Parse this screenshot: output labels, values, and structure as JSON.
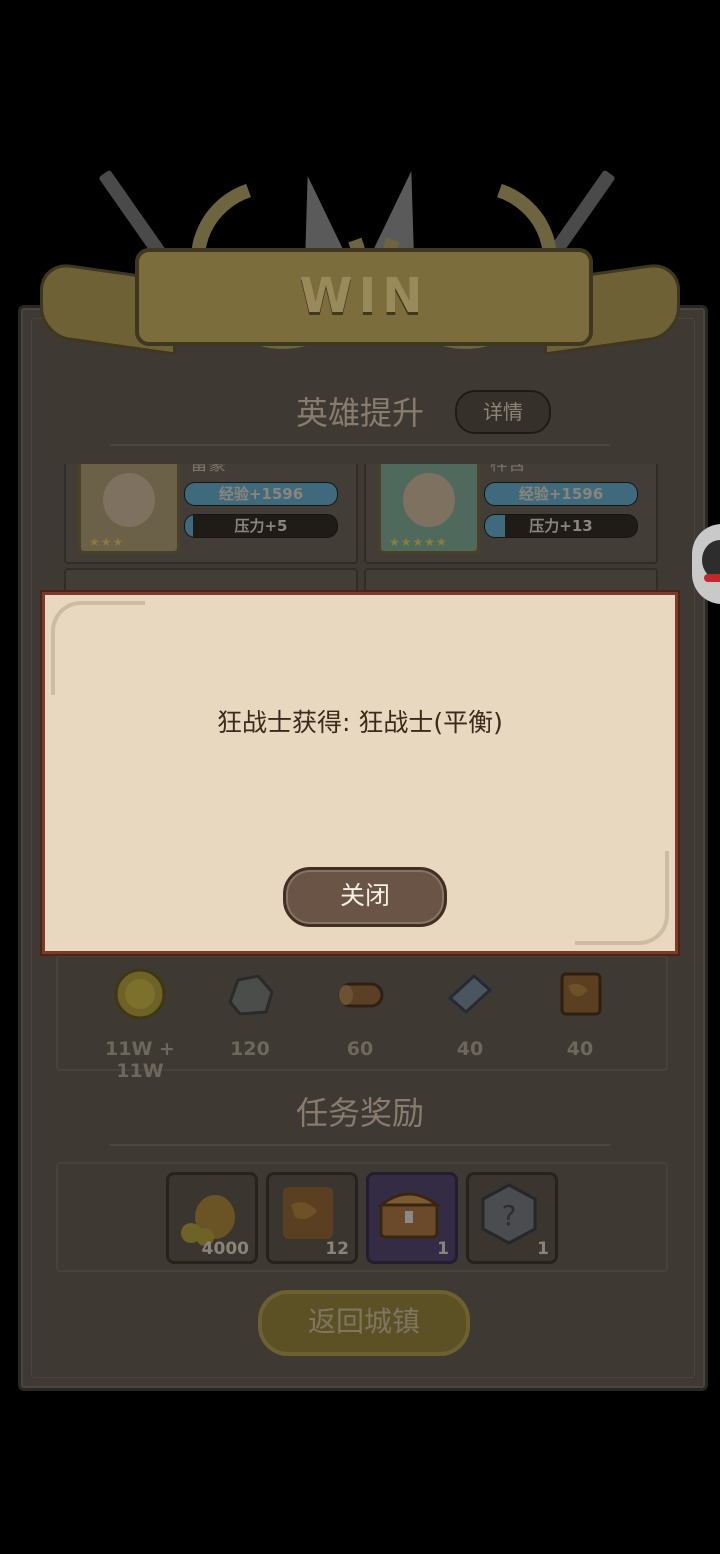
{
  "banner": {
    "title": "WIN"
  },
  "hero_section": {
    "title": "英雄提升",
    "detail_button": "详情",
    "heroes": [
      {
        "name": "雷豪",
        "exp": "经验+1596",
        "stress": "压力+5",
        "stars": "★★★",
        "stress_fill": 0.05
      },
      {
        "name": "梓含",
        "exp": "经验+1596",
        "stress": "压力+13",
        "stars": "★★★★★",
        "stress_fill": 0.13
      }
    ]
  },
  "resources": [
    {
      "icon": "gold-coin-icon",
      "value": "11W + 11W"
    },
    {
      "icon": "stone-ore-icon",
      "value": "120"
    },
    {
      "icon": "wood-log-icon",
      "value": "60"
    },
    {
      "icon": "iron-ingot-icon",
      "value": "40"
    },
    {
      "icon": "leather-hide-icon",
      "value": "40"
    }
  ],
  "task_section": {
    "title": "任务奖励",
    "rewards": [
      {
        "icon": "gold-bag-icon",
        "count": "4000"
      },
      {
        "icon": "leather-hide-icon",
        "count": "12"
      },
      {
        "icon": "treasure-chest-icon",
        "count": "1"
      },
      {
        "icon": "mystery-gem-icon",
        "count": "1"
      }
    ]
  },
  "return_button": "返回城镇",
  "dialog": {
    "message": "狂战士获得: 狂战士(平衡)",
    "close_button": "关闭"
  },
  "colors": {
    "dialog_bg": "#e8d8bf",
    "dialog_border": "#7b3b28",
    "banner": "#7c6d3c"
  }
}
